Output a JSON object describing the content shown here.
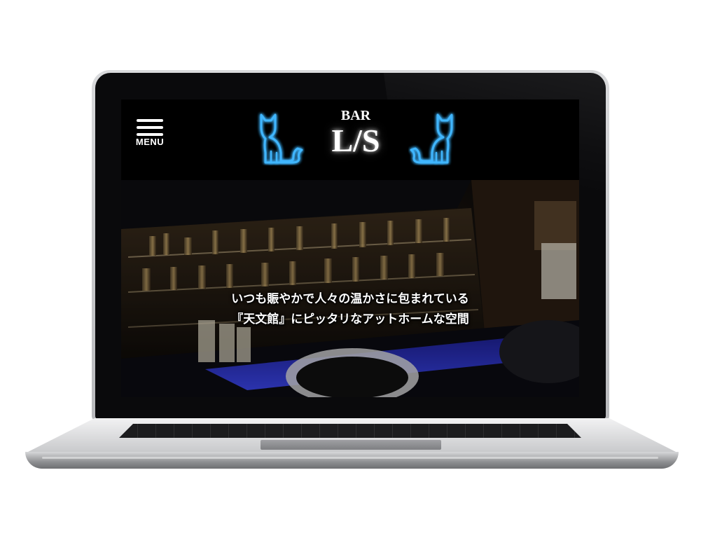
{
  "header": {
    "menu_label": "MENU",
    "logo_small": "BAR",
    "logo_big": "L/S"
  },
  "hero": {
    "caption_line1": "いつも賑やかで人々の温かさに包まれている",
    "caption_line2": "『天文館』にピッタリなアットホームな空間"
  },
  "colors": {
    "neon_blue": "#2aa8ff",
    "background": "#000000"
  },
  "icons": [
    "menu-icon",
    "neon-cat-icon"
  ]
}
